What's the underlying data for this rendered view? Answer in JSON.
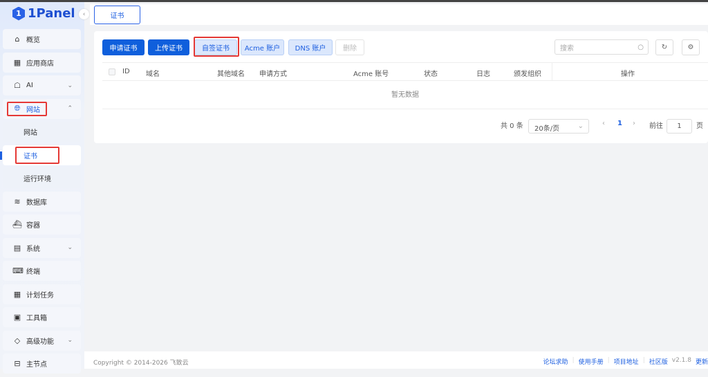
{
  "app": {
    "logo": "1Panel"
  },
  "sidebar": {
    "items": [
      {
        "label": "概览",
        "icon": "home-icon"
      },
      {
        "label": "应用商店",
        "icon": "grid-icon"
      },
      {
        "label": "AI",
        "icon": "robot-icon"
      },
      {
        "label": "网站",
        "icon": "globe-icon"
      },
      {
        "label": "网站"
      },
      {
        "label": "证书"
      },
      {
        "label": "运行环境"
      },
      {
        "label": "数据库",
        "icon": "layers-icon"
      },
      {
        "label": "容器",
        "icon": "docker-icon"
      },
      {
        "label": "系统",
        "icon": "server-icon"
      },
      {
        "label": "终端",
        "icon": "terminal-icon"
      },
      {
        "label": "计划任务",
        "icon": "calendar-icon"
      },
      {
        "label": "工具箱",
        "icon": "toolbox-icon"
      },
      {
        "label": "高级功能",
        "icon": "diamond-icon"
      },
      {
        "label": "主节点",
        "icon": "node-icon"
      }
    ]
  },
  "tabs": [
    {
      "label": "证书"
    }
  ],
  "toolbar": {
    "apply": "申请证书",
    "upload": "上传证书",
    "self_signed": "自签证书",
    "acme": "Acme 账户",
    "dns": "DNS 账户",
    "delete": "删除",
    "search_placeholder": "搜索"
  },
  "table": {
    "columns": [
      "ID",
      "域名",
      "其他域名",
      "申请方式",
      "Acme 账号",
      "状态",
      "日志",
      "颁发组织",
      "操作"
    ],
    "empty": "暂无数据"
  },
  "pagination": {
    "total": "共 0 条",
    "page_size": "20条/页",
    "current": "1",
    "goto": "前往",
    "goto_value": "1",
    "page_suffix": "页"
  },
  "footer": {
    "copyright": "Copyright © 2014-2026 飞致云",
    "links": [
      "论坛求助",
      "使用手册",
      "项目地址",
      "社区版"
    ],
    "version": "v2.1.8",
    "update": "更新"
  },
  "colors": {
    "primary": "#0f5fdc",
    "highlight": "#e53935"
  }
}
